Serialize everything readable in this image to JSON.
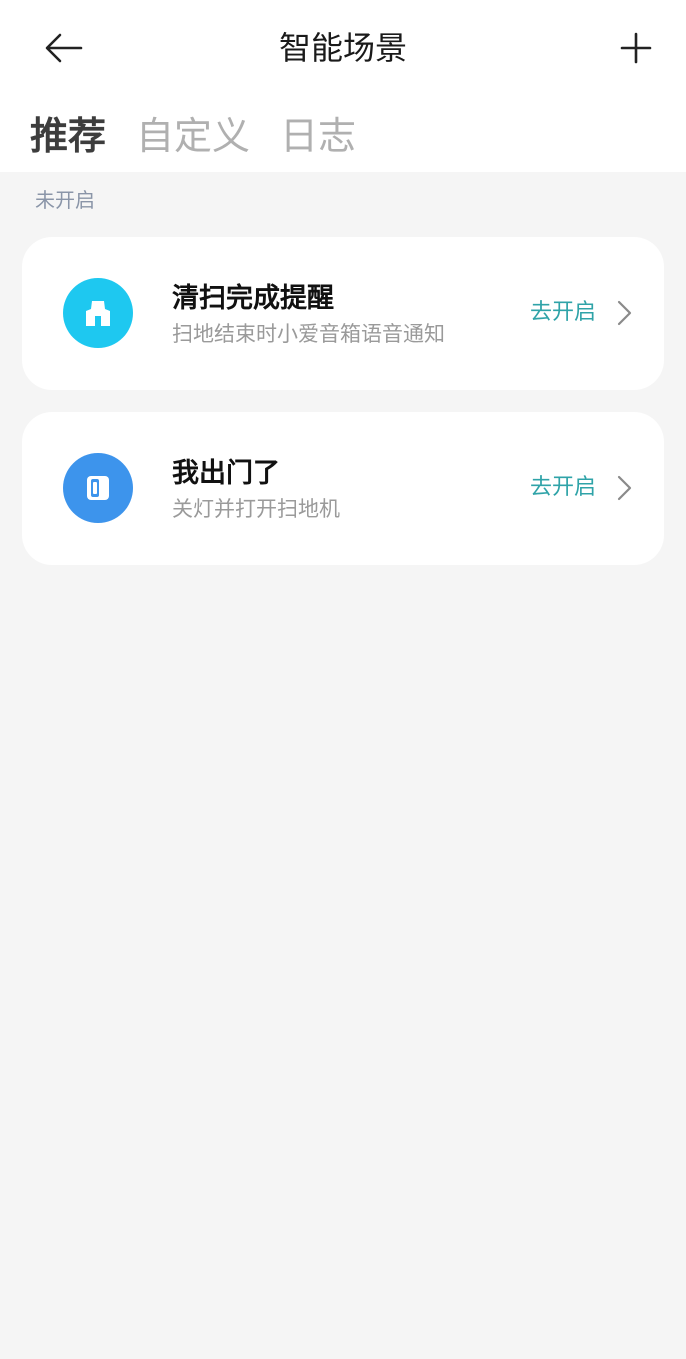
{
  "header": {
    "title": "智能场景",
    "back_icon": "back-arrow-icon",
    "add_icon": "plus-icon"
  },
  "tabs": [
    {
      "label": "推荐",
      "active": true
    },
    {
      "label": "自定义",
      "active": false
    },
    {
      "label": "日志",
      "active": false
    }
  ],
  "section": {
    "label": "未开启"
  },
  "scenes": [
    {
      "title": "清扫完成提醒",
      "subtitle": "扫地结束时小爱音箱语音通知",
      "action": "去开启",
      "icon": "speaker-icon",
      "icon_color": "#1ec8f0"
    },
    {
      "title": "我出门了",
      "subtitle": "关灯并打开扫地机",
      "action": "去开启",
      "icon": "door-icon",
      "icon_color": "#3d94ec"
    }
  ],
  "colors": {
    "accent": "#2fa3a8",
    "background": "#f5f5f5"
  }
}
